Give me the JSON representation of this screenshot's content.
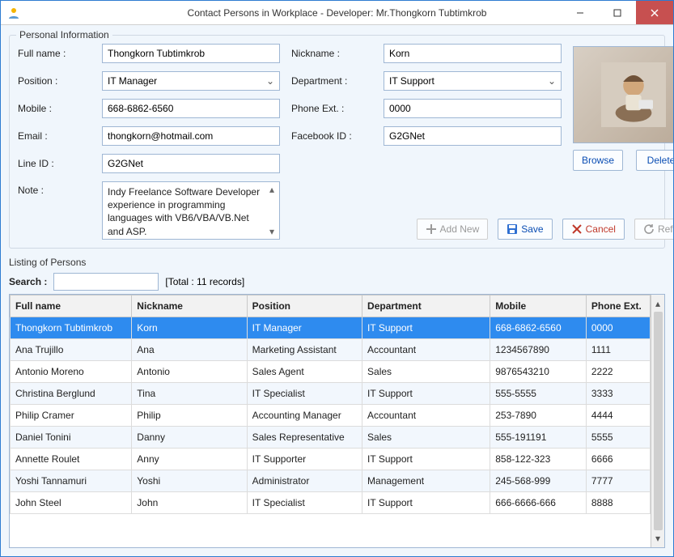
{
  "window": {
    "title": "Contact Persons in Workplace - Developer: Mr.Thongkorn Tubtimkrob"
  },
  "form": {
    "groupTitle": "Personal Information",
    "labels": {
      "fullName": "Full name :",
      "position": "Position :",
      "mobile": "Mobile :",
      "email": "Email :",
      "lineId": "Line ID :",
      "note": "Note :",
      "nickname": "Nickname :",
      "department": "Department :",
      "phoneExt": "Phone Ext. :",
      "facebook": "Facebook ID :"
    },
    "values": {
      "fullName": "Thongkorn Tubtimkrob",
      "position": "IT Manager",
      "mobile": "668-6862-6560",
      "email": "thongkorn@hotmail.com",
      "lineId": "G2GNet",
      "note": "Indy Freelance Software Developer experience in programming languages with VB6/VBA/VB.Net and ASP.",
      "nickname": "Korn",
      "department": "IT Support",
      "phoneExt": "0000",
      "facebook": "G2GNet"
    },
    "buttons": {
      "browse": "Browse",
      "delete": "Delete",
      "addNew": "Add New",
      "save": "Save",
      "cancel": "Cancel",
      "refresh": "Refresh"
    }
  },
  "listing": {
    "title": "Listing of Persons",
    "searchLabel": "Search :",
    "totalText": "[Total : 11 records]",
    "headers": {
      "fullName": "Full name",
      "nickname": "Nickname",
      "position": "Position",
      "department": "Department",
      "mobile": "Mobile",
      "phoneExt": "Phone Ext."
    },
    "rows": [
      {
        "fullName": "Thongkorn Tubtimkrob",
        "nickname": "Korn",
        "position": "IT Manager",
        "department": "IT Support",
        "mobile": "668-6862-6560",
        "phoneExt": "0000",
        "selected": true
      },
      {
        "fullName": "Ana Trujillo",
        "nickname": "Ana",
        "position": "Marketing Assistant",
        "department": "Accountant",
        "mobile": "1234567890",
        "phoneExt": "1111"
      },
      {
        "fullName": "Antonio Moreno",
        "nickname": "Antonio",
        "position": "Sales Agent",
        "department": "Sales",
        "mobile": "9876543210",
        "phoneExt": "2222"
      },
      {
        "fullName": "Christina Berglund",
        "nickname": "Tina",
        "position": "IT Specialist",
        "department": "IT Support",
        "mobile": "555-5555",
        "phoneExt": "3333"
      },
      {
        "fullName": "Philip Cramer",
        "nickname": "Philip",
        "position": "Accounting Manager",
        "department": "Accountant",
        "mobile": "253-7890",
        "phoneExt": "4444"
      },
      {
        "fullName": "Daniel Tonini",
        "nickname": "Danny",
        "position": "Sales Representative",
        "department": "Sales",
        "mobile": "555-191191",
        "phoneExt": "5555"
      },
      {
        "fullName": "Annette Roulet",
        "nickname": "Anny",
        "position": "IT Supporter",
        "department": "IT Support",
        "mobile": "858-122-323",
        "phoneExt": "6666"
      },
      {
        "fullName": "Yoshi Tannamuri",
        "nickname": "Yoshi",
        "position": "Administrator",
        "department": "Management",
        "mobile": "245-568-999",
        "phoneExt": "7777"
      },
      {
        "fullName": "John Steel",
        "nickname": "John",
        "position": "IT Specialist",
        "department": "IT Support",
        "mobile": "666-6666-666",
        "phoneExt": "8888"
      }
    ]
  }
}
